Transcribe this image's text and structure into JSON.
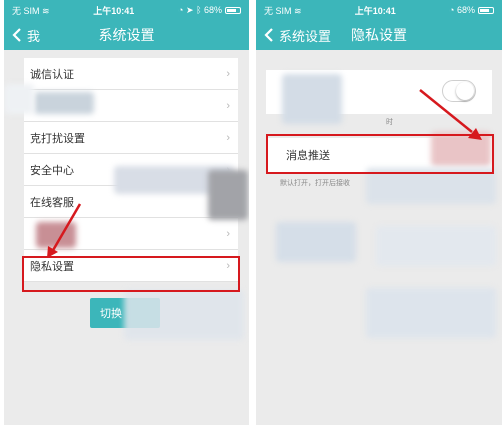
{
  "left": {
    "status": {
      "carrier": "无 SIM",
      "time": "上午10:41",
      "battery": "68%"
    },
    "nav": {
      "back_label": "我",
      "title": "系统设置"
    },
    "items": [
      "诚信认证",
      "",
      "克打扰设置",
      "安全中心",
      "在线客服",
      "",
      "隐私设置"
    ],
    "button_label": "切换"
  },
  "right": {
    "status": {
      "carrier": "无 SIM",
      "time": "上午10:41",
      "battery": "68%"
    },
    "nav": {
      "back_label": "系统设置",
      "title": "隐私设置"
    },
    "push_label": "消息推送",
    "push_hint": "默认打开，打开后接收",
    "trunc_text": "时",
    "toggle_on": 0
  },
  "colors": {
    "header": "#3cb6ba",
    "highlight": "#d6191e",
    "background": "#ebebeb"
  }
}
